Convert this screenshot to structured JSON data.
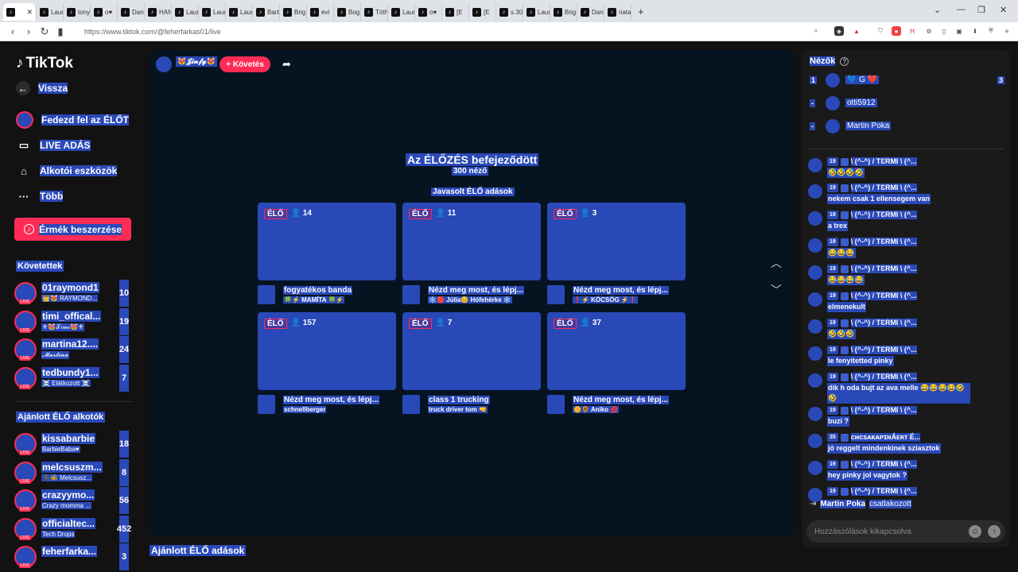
{
  "browser": {
    "tabs": [
      "",
      "Laur",
      "tony",
      "o♥",
      "Dan",
      "HAN",
      "Laur",
      "Laur",
      "Laur",
      "Barb",
      "Brig",
      "evi",
      "Bog",
      "Tóth",
      "Laur",
      "o♥",
      "[E",
      "[E",
      "s.30",
      "Laur",
      "Brig",
      "Dan",
      "nata"
    ],
    "url": "https://www.tiktok.com/@feherfarkas01/live"
  },
  "sidebar": {
    "logo": "TikTok",
    "back": "Vissza",
    "nav": [
      "Fedezd fel az ÉLŐT",
      "LIVE ADÁS",
      "Alkotói eszközök",
      "Több"
    ],
    "coins_button": "Érmék beszerzése",
    "followed_header": "Követettek",
    "followed": [
      {
        "name": "01raymond1",
        "sub": "👑😻 RAYMOND...",
        "count": "10"
      },
      {
        "name": "timi_offical...",
        "sub": "⚜😻𝒯𝒾𝓂𝒾😻⚜",
        "count": "19"
      },
      {
        "name": "martina12....",
        "sub": "𝓜𝓪𝓻𝓽𝓲𝓷𝓪",
        "count": "24"
      },
      {
        "name": "tedbundy1...",
        "sub": "☠️ Elátkozott ☠️",
        "count": "7"
      }
    ],
    "recommended_header": "Ajánlott ÉLŐ alkotók",
    "recommended": [
      {
        "name": "kissabarbie",
        "sub": "BarbieBaba♥",
        "count": "18"
      },
      {
        "name": "melcsuszm...",
        "sub": "🐈‍⬛🐝 Melcsusz...",
        "count": "8"
      },
      {
        "name": "crazyymo...",
        "sub": "Crazy momma ...",
        "count": "56"
      },
      {
        "name": "officialtec...",
        "sub": "Tech Drops",
        "count": "452"
      },
      {
        "name": "feherfarka...",
        "sub": "",
        "count": "3"
      }
    ],
    "live_badge": "LIVE"
  },
  "main": {
    "host_name": "😻𝓙𝓲𝓷𝓯𝔂😻",
    "follow_button": "+ Követés",
    "ended_title": "Az ÉLŐZÉS befejeződött",
    "viewers": "300 néző",
    "suggested_header": "Javasolt ÉLŐ adások",
    "live_label": "ÉLŐ",
    "cards": [
      {
        "viewers": "14",
        "title": "fogyatékos banda",
        "sub": "🍀⚡ MAMÍTA 🍀⚡"
      },
      {
        "viewers": "11",
        "title": "Nézd meg most, és lépj...",
        "sub": "❄️🔴 Júlia😊 Hófehérke ❄️"
      },
      {
        "viewers": "3",
        "title": "Nézd meg most, és lépj...",
        "sub": "❗⚡ KÖCSÖG ⚡❗"
      },
      {
        "viewers": "157",
        "title": "Nézd meg most, és lépj...",
        "sub": "schnellberger"
      },
      {
        "viewers": "7",
        "title": "class 1 trucking",
        "sub": "truck driver tom 🤜"
      },
      {
        "viewers": "37",
        "title": "Nézd meg most, és lépj...",
        "sub": "🌼🌻 Aniko 💋"
      }
    ],
    "bottom_header": "Ajánlott ÉLŐ adások"
  },
  "panel": {
    "viewers_header": "Nézők",
    "top_viewers": [
      {
        "rank": "1",
        "name": "💙 G ❤️",
        "count": "3"
      },
      {
        "rank": "-",
        "name": "otti5912",
        "count": ""
      },
      {
        "rank": "-",
        "name": "Martin Poka",
        "count": ""
      }
    ],
    "chat": [
      {
        "level": "19",
        "user": "\\ (^-^) / TƐRMI \\ (^...",
        "text": "🤣🤣🤣🤣"
      },
      {
        "level": "19",
        "user": "\\ (^-^) / TƐRMI \\ (^...",
        "text": "nekem csak 1 ellensegem van"
      },
      {
        "level": "19",
        "user": "\\ (^-^) / TƐRMI \\ (^...",
        "text": "a trex"
      },
      {
        "level": "19",
        "user": "\\ (^-^) / TƐRMI \\ (^...",
        "text": "😂😂😂"
      },
      {
        "level": "19",
        "user": "\\ (^-^) / TƐRMI \\ (^...",
        "text": "😂😂😂😂"
      },
      {
        "level": "19",
        "user": "\\ (^-^) / TƐRMI \\ (^...",
        "text": "elmenekult"
      },
      {
        "level": "19",
        "user": "\\ (^-^) / TƐRMI \\ (^...",
        "text": "🤣🤣🤣"
      },
      {
        "level": "19",
        "user": "\\ (^-^) / TƐRMI \\ (^...",
        "text": "le fenyitetted pinky"
      },
      {
        "level": "19",
        "user": "\\ (^-^) / TƐRMI \\ (^...",
        "text": "dik h oda bujt az ava melle 😂😂😂😂🤣🤣"
      },
      {
        "level": "19",
        "user": "\\ (^-^) / TƐRMI \\ (^...",
        "text": "buzi ?"
      },
      {
        "level": "35",
        "user": "ᴄʜᴄsᴀᴋᴀᴘɪɴÁᴇʀᴛ É...",
        "text": "jó reggelt mindenkinek sziasztok"
      },
      {
        "level": "19",
        "user": "\\ (^-^) / TƐRMI \\ (^...",
        "text": "hey pinky jol vagytok ?"
      },
      {
        "level": "19",
        "user": "\\ (^-^) / TƐRMI \\ (^...",
        "text": ""
      }
    ],
    "joined_user": "Martin Poka",
    "joined_text": "csatlakozott",
    "comment_placeholder": "Hozzászólások kikapcsolva"
  }
}
